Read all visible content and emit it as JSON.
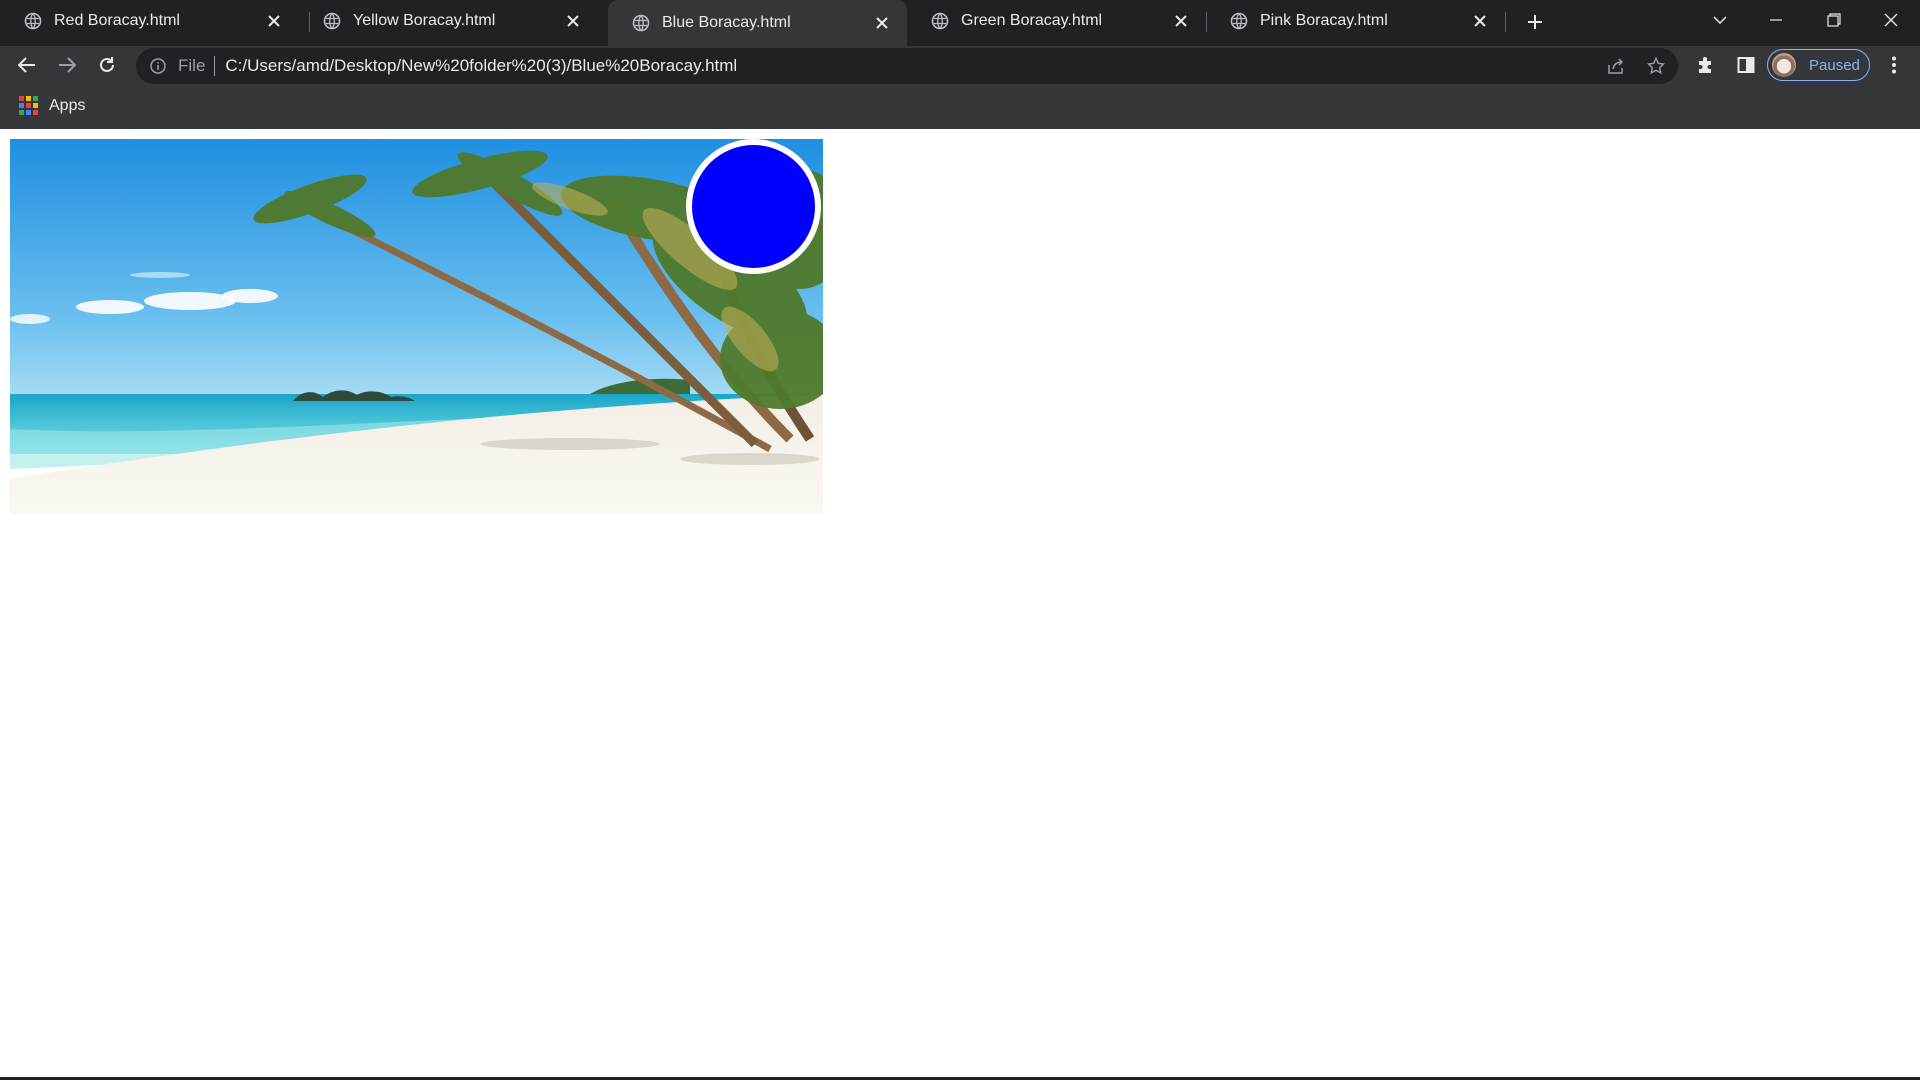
{
  "browser": {
    "tabs": [
      {
        "title": "Red Boracay.html",
        "active": false
      },
      {
        "title": "Yellow Boracay.html",
        "active": false
      },
      {
        "title": "Blue Boracay.html",
        "active": true
      },
      {
        "title": "Green Boracay.html",
        "active": false
      },
      {
        "title": "Pink Boracay.html",
        "active": false
      }
    ],
    "omnibox": {
      "scheme_label": "File",
      "url": "C:/Users/amd/Desktop/New%20folder%20(3)/Blue%20Boracay.html"
    },
    "profile": {
      "label": "Paused"
    },
    "bookmarks": {
      "apps_label": "Apps"
    }
  },
  "page": {
    "circle_color": "#0000ff",
    "image_subject": "beach-with-palm-trees"
  },
  "icons": {
    "tab_favicon": "globe-icon",
    "tab_close": "close-icon",
    "new_tab": "plus-icon",
    "back": "back-arrow-icon",
    "forward": "forward-arrow-icon",
    "reload": "reload-icon",
    "info": "info-icon",
    "share": "share-icon",
    "bookmark": "star-icon",
    "extensions": "puzzle-icon",
    "side_panel": "side-panel-icon",
    "menu": "kebab-menu-icon"
  }
}
